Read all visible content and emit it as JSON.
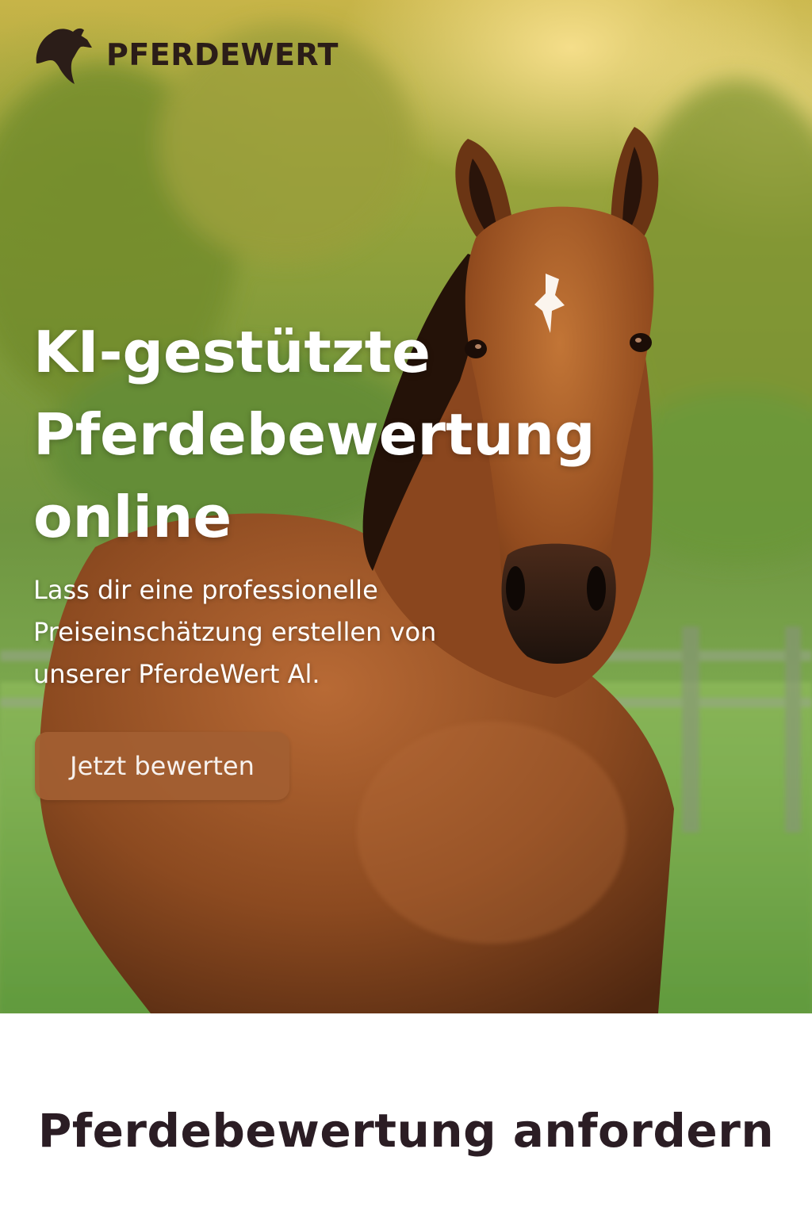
{
  "brand": {
    "name": "PFERDEWERT",
    "logo_icon": "horse-head-icon",
    "text_color": "#2b1d18"
  },
  "hero": {
    "title_lines": [
      "KI-gestützte",
      "Pferdebewertung",
      "online"
    ],
    "subtitle_lines": [
      "Lass dir eine professionelle",
      "Preiseinschätzung erstellen von",
      "unserer PferdeWert Al."
    ],
    "cta_label": "Jetzt bewerten",
    "cta_color": "#a35f32",
    "background_image": "horse-photo"
  },
  "section": {
    "heading": "Pferdebewertung anfordern"
  }
}
